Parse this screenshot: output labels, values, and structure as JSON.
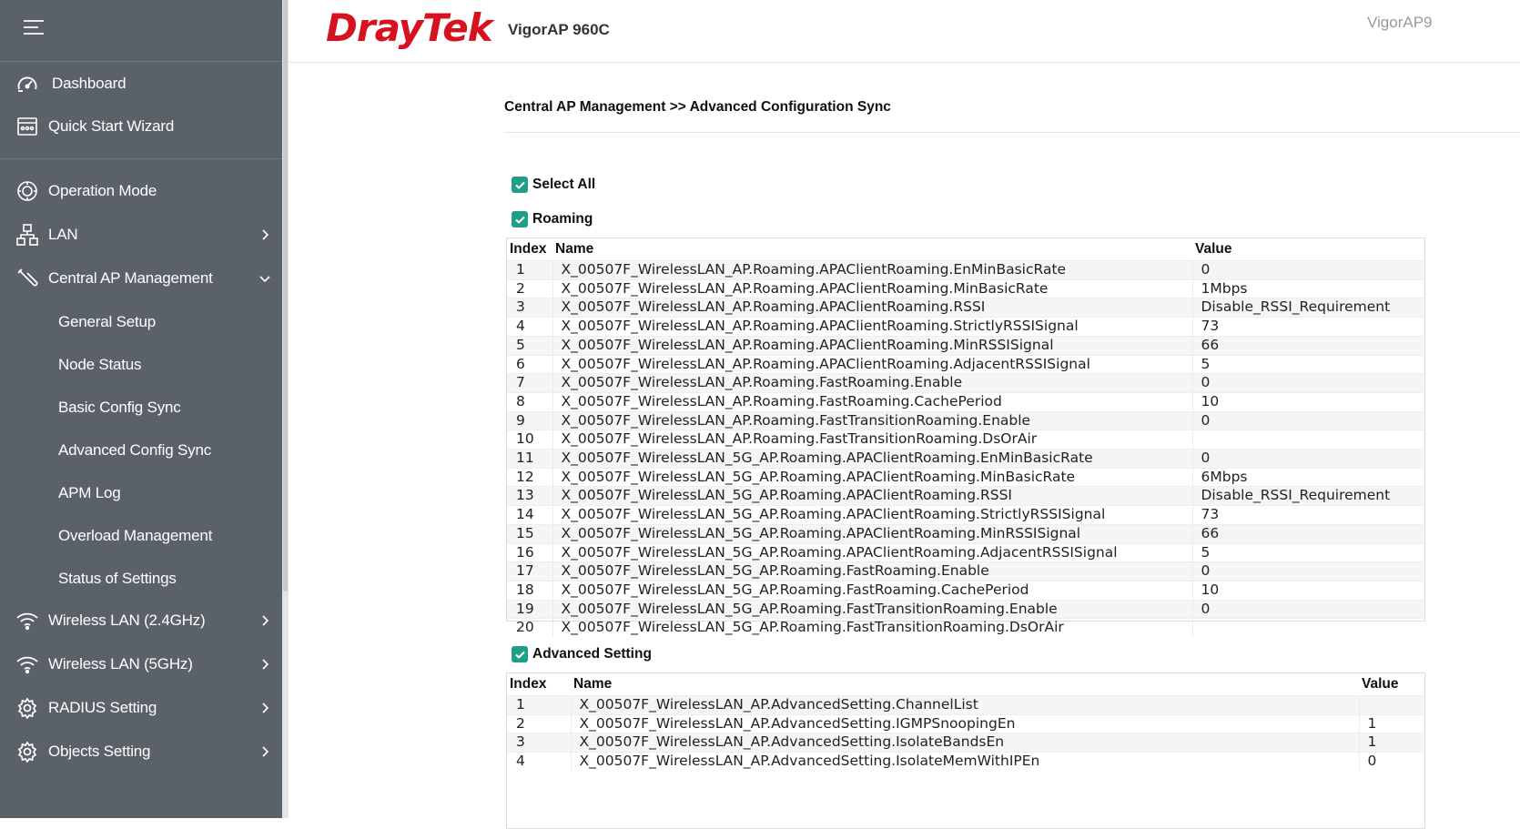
{
  "sidebar": {
    "items": [
      {
        "label": "Dashboard",
        "icon": "gauge-icon"
      },
      {
        "label": "Quick Start Wizard",
        "icon": "wizard-icon"
      },
      {
        "label": "Operation Mode",
        "icon": "operation-mode-icon"
      },
      {
        "label": "LAN",
        "icon": "lan-icon"
      },
      {
        "label": "Central AP Management",
        "icon": "wrench-icon"
      },
      {
        "label": "General Setup"
      },
      {
        "label": "Node Status"
      },
      {
        "label": "Basic Config Sync"
      },
      {
        "label": "Advanced Config Sync"
      },
      {
        "label": "APM Log"
      },
      {
        "label": "Overload Management"
      },
      {
        "label": "Status of Settings"
      },
      {
        "label": "Wireless LAN (2.4GHz)",
        "icon": "wifi-icon"
      },
      {
        "label": "Wireless LAN (5GHz)",
        "icon": "wifi-icon"
      },
      {
        "label": "RADIUS Setting",
        "icon": "gear-icon"
      },
      {
        "label": "Objects Setting",
        "icon": "gear-icon"
      }
    ]
  },
  "header": {
    "logo": "DrayTek",
    "model": "VigorAP 960C",
    "model_right": "VigorAP9"
  },
  "main": {
    "breadcrumb": "Central AP Management >> Advanced Configuration Sync",
    "select_all": "Select All",
    "roaming": {
      "title": "Roaming",
      "headers": [
        "Index",
        "Name",
        "Value"
      ],
      "rows": [
        [
          "1",
          "X_00507F_WirelessLAN_AP.Roaming.APAClientRoaming.EnMinBasicRate",
          "0"
        ],
        [
          "2",
          "X_00507F_WirelessLAN_AP.Roaming.APAClientRoaming.MinBasicRate",
          "1Mbps"
        ],
        [
          "3",
          "X_00507F_WirelessLAN_AP.Roaming.APAClientRoaming.RSSI",
          "Disable_RSSI_Requirement"
        ],
        [
          "4",
          "X_00507F_WirelessLAN_AP.Roaming.APAClientRoaming.StrictlyRSSISignal",
          "73"
        ],
        [
          "5",
          "X_00507F_WirelessLAN_AP.Roaming.APAClientRoaming.MinRSSISignal",
          "66"
        ],
        [
          "6",
          "X_00507F_WirelessLAN_AP.Roaming.APAClientRoaming.AdjacentRSSISignal",
          "5"
        ],
        [
          "7",
          "X_00507F_WirelessLAN_AP.Roaming.FastRoaming.Enable",
          "0"
        ],
        [
          "8",
          "X_00507F_WirelessLAN_AP.Roaming.FastRoaming.CachePeriod",
          "10"
        ],
        [
          "9",
          "X_00507F_WirelessLAN_AP.Roaming.FastTransitionRoaming.Enable",
          "0"
        ],
        [
          "10",
          "X_00507F_WirelessLAN_AP.Roaming.FastTransitionRoaming.DsOrAir",
          ""
        ],
        [
          "11",
          "X_00507F_WirelessLAN_5G_AP.Roaming.APAClientRoaming.EnMinBasicRate",
          "0"
        ],
        [
          "12",
          "X_00507F_WirelessLAN_5G_AP.Roaming.APAClientRoaming.MinBasicRate",
          "6Mbps"
        ],
        [
          "13",
          "X_00507F_WirelessLAN_5G_AP.Roaming.APAClientRoaming.RSSI",
          "Disable_RSSI_Requirement"
        ],
        [
          "14",
          "X_00507F_WirelessLAN_5G_AP.Roaming.APAClientRoaming.StrictlyRSSISignal",
          "73"
        ],
        [
          "15",
          "X_00507F_WirelessLAN_5G_AP.Roaming.APAClientRoaming.MinRSSISignal",
          "66"
        ],
        [
          "16",
          "X_00507F_WirelessLAN_5G_AP.Roaming.APAClientRoaming.AdjacentRSSISignal",
          "5"
        ],
        [
          "17",
          "X_00507F_WirelessLAN_5G_AP.Roaming.FastRoaming.Enable",
          "0"
        ],
        [
          "18",
          "X_00507F_WirelessLAN_5G_AP.Roaming.FastRoaming.CachePeriod",
          "10"
        ],
        [
          "19",
          "X_00507F_WirelessLAN_5G_AP.Roaming.FastTransitionRoaming.Enable",
          "0"
        ],
        [
          "20",
          "X_00507F_WirelessLAN_5G_AP.Roaming.FastTransitionRoaming.DsOrAir",
          ""
        ]
      ]
    },
    "advanced": {
      "title": "Advanced Setting",
      "headers": [
        "Index",
        "Name",
        "Value"
      ],
      "rows": [
        [
          "1",
          "X_00507F_WirelessLAN_AP.AdvancedSetting.ChannelList",
          ""
        ],
        [
          "2",
          "X_00507F_WirelessLAN_AP.AdvancedSetting.IGMPSnoopingEn",
          "1"
        ],
        [
          "3",
          "X_00507F_WirelessLAN_AP.AdvancedSetting.IsolateBandsEn",
          "1"
        ],
        [
          "4",
          "X_00507F_WirelessLAN_AP.AdvancedSetting.IsolateMemWithIPEn",
          "0"
        ]
      ]
    }
  },
  "colors": {
    "sidebar_bg": "#5b6168",
    "brand_red": "#d7121f",
    "checkbox_teal": "#1f9e8a"
  }
}
